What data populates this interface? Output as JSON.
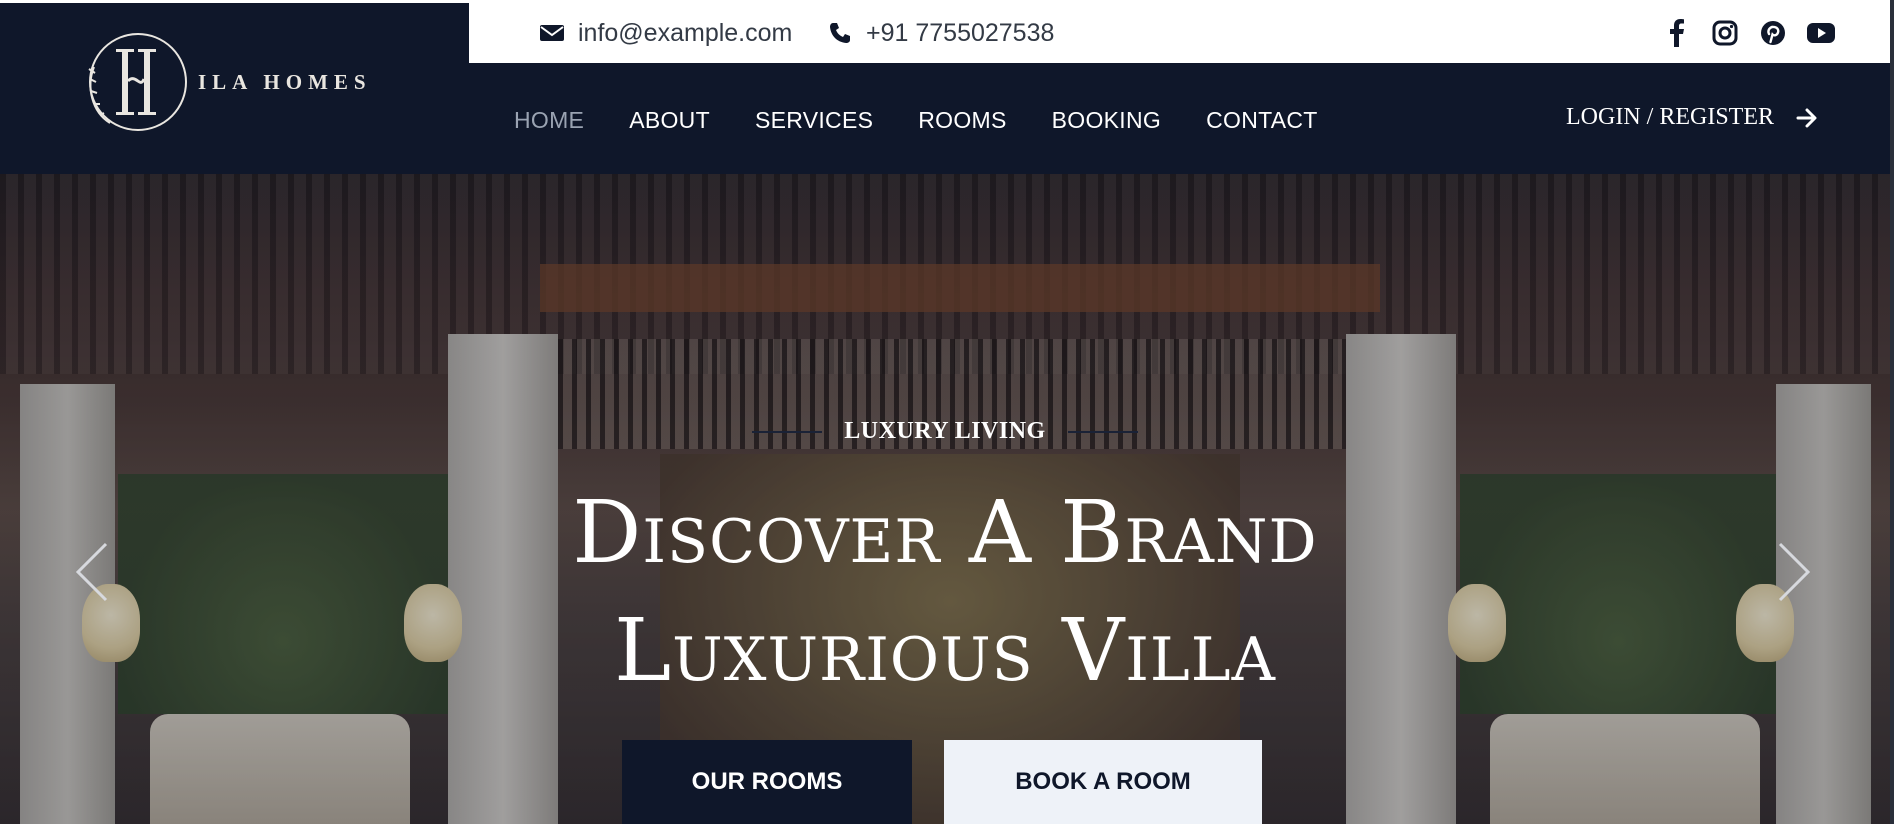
{
  "brand": {
    "name": "ILA HOMES",
    "logo_letters": "IH"
  },
  "topbar": {
    "email": "info@example.com",
    "phone": "+91 7755027538",
    "email_icon": "envelope-icon",
    "phone_icon": "phone-icon",
    "social": [
      "facebook-icon",
      "instagram-icon",
      "pinterest-icon",
      "youtube-icon"
    ]
  },
  "nav": {
    "items": [
      "HOME",
      "ABOUT",
      "SERVICES",
      "ROOMS",
      "BOOKING",
      "CONTACT"
    ],
    "active": "HOME"
  },
  "login": {
    "label": "LOGIN / REGISTER",
    "icon": "arrow-right-icon"
  },
  "hero": {
    "eyebrow": "LUXURY LIVING",
    "title_line1": "Discover A Brand",
    "title_line2": "Luxurious Villa",
    "primary_button": "OUR ROOMS",
    "secondary_button": "BOOK A ROOM",
    "prev_icon": "chevron-left-icon",
    "next_icon": "chevron-right-icon"
  },
  "colors": {
    "navy": "#0f172a",
    "white": "#ffffff",
    "nav_active": "#9aa3b2",
    "button_light": "#eef2f8"
  }
}
